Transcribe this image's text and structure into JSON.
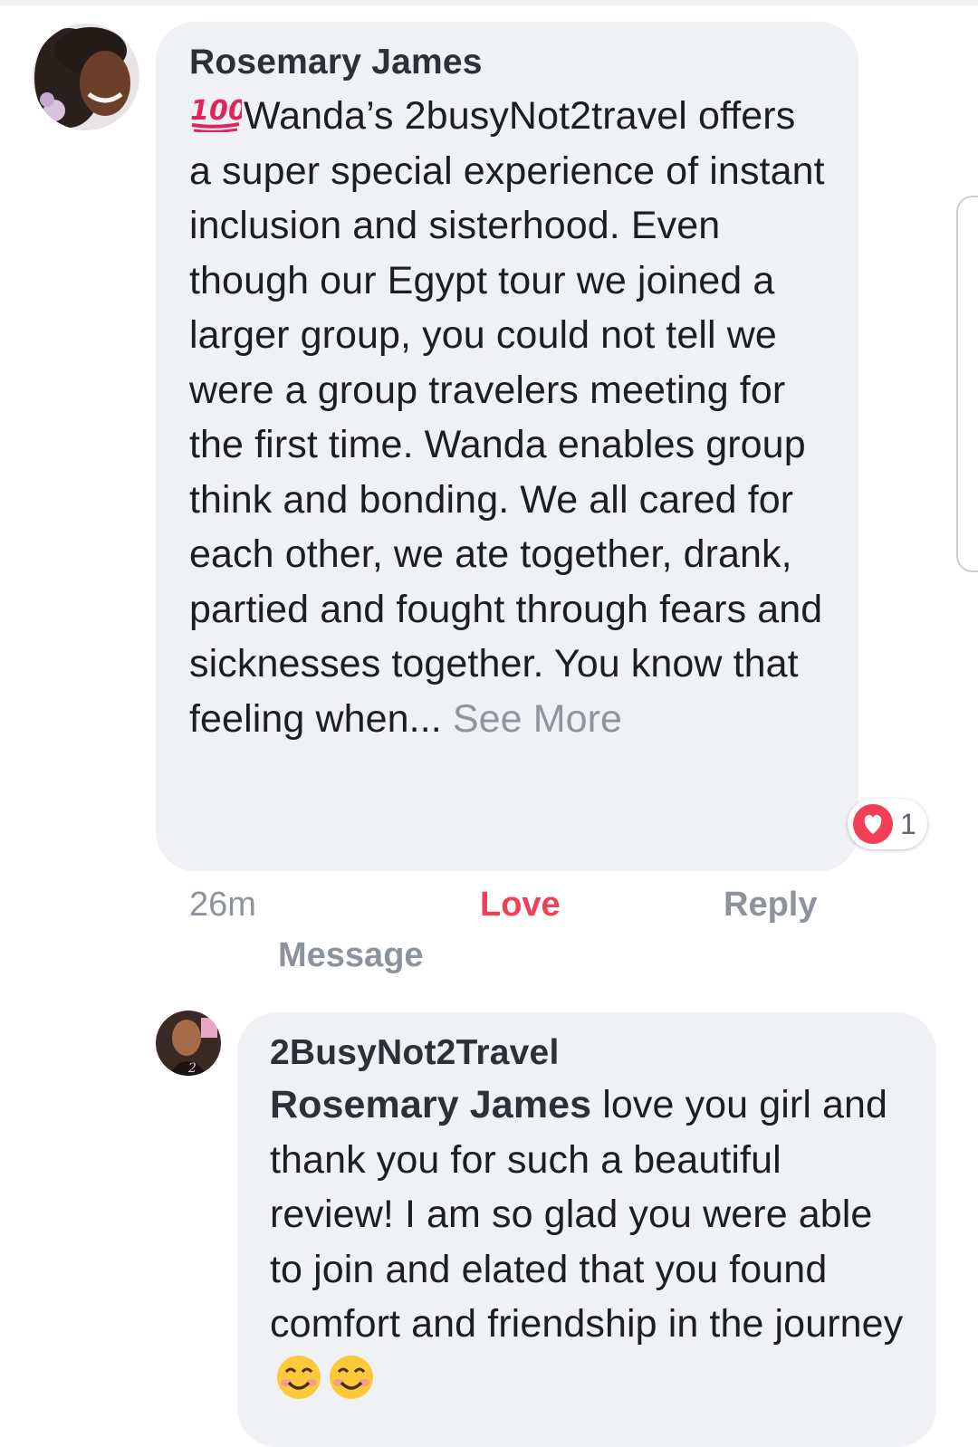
{
  "colors": {
    "bubble": "#f0f1f4",
    "love": "#f33e58",
    "meta_gray": "#8d939c",
    "text": "#1c1e21"
  },
  "comment": {
    "author": "Rosemary James",
    "leading_emoji": "100-points-emoji",
    "text": "Wanda’s 2busyNot2travel offers a super special experience of instant inclusion and sisterhood. Even though our Egypt tour we joined a larger group, you could not tell we were a group travelers meeting for the first time. Wanda enables group think and bonding. We all cared for each other, we ate together, drank, partied and fought through fears and sicknesses together. You know that feeling when...",
    "see_more": "See More",
    "reaction": {
      "icon": "love-reaction-icon",
      "count": "1"
    },
    "actions": {
      "time": "26m",
      "love": "Love",
      "reply": "Reply",
      "message": "Message"
    }
  },
  "reply": {
    "author": "2BusyNot2Travel",
    "mention": "Rosemary James",
    "text": "love you girl and thank you for such a beautiful review! I am so glad you were able to join and elated that you found comfort and friendship in the journey",
    "trailing_emoji": [
      "smiling-face-emoji",
      "smiling-face-emoji"
    ]
  }
}
